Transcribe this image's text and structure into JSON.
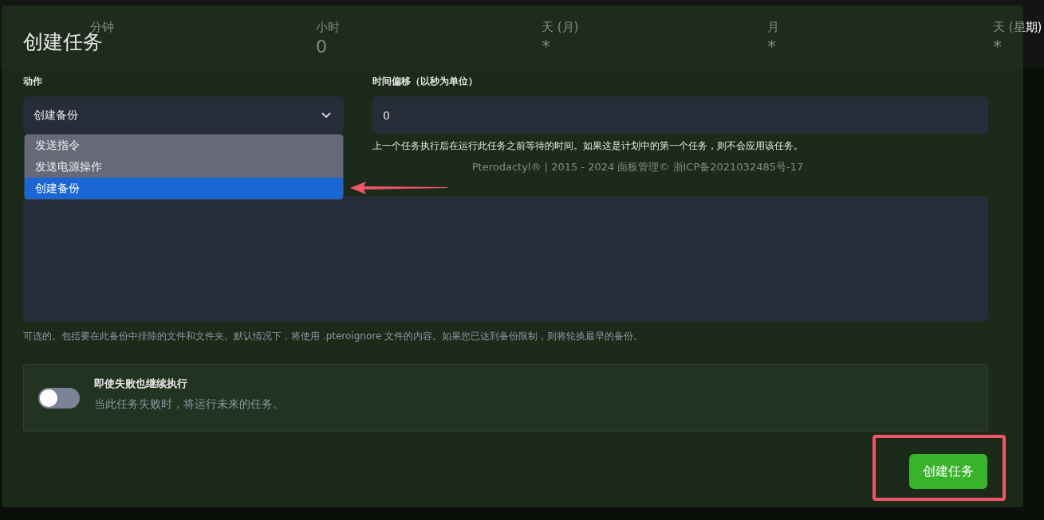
{
  "background": {
    "cron_fields": [
      {
        "label": "分钟"
      },
      {
        "label": "小时",
        "value": "0"
      },
      {
        "label": "天 (月)",
        "value": "*"
      },
      {
        "label": "月",
        "value": "*"
      },
      {
        "label": "天 (星期)",
        "value": "*"
      }
    ],
    "footer": "Pterodactyl® | 2015 - 2024 面板管理© 浙ICP备2021032485号-17"
  },
  "modal": {
    "title": "创建任务",
    "action": {
      "label": "动作",
      "value": "创建备份",
      "expanded": true,
      "options": [
        {
          "label": "发送指令",
          "selected": false
        },
        {
          "label": "发送电源操作",
          "selected": false
        },
        {
          "label": "创建备份",
          "selected": true
        }
      ]
    },
    "offset": {
      "label": "时间偏移（以秒为单位）",
      "value": "0",
      "help": "上一个任务执行后在运行此任务之前等待的时间。如果这是计划中的第一个任务，则不会应用该任务。"
    },
    "ignored_files": {
      "help": "可选的。包括要在此备份中排除的文件和文件夹。默认情况下，将使用 .pteroignore 文件的内容。如果您已达到备份限制，则将轮换最早的备份。"
    },
    "continue_on_failure": {
      "label": "即使失败也继续执行",
      "description": "当此任务失败时，将运行未来的任务。",
      "on": false
    },
    "submit": "创建任务"
  }
}
